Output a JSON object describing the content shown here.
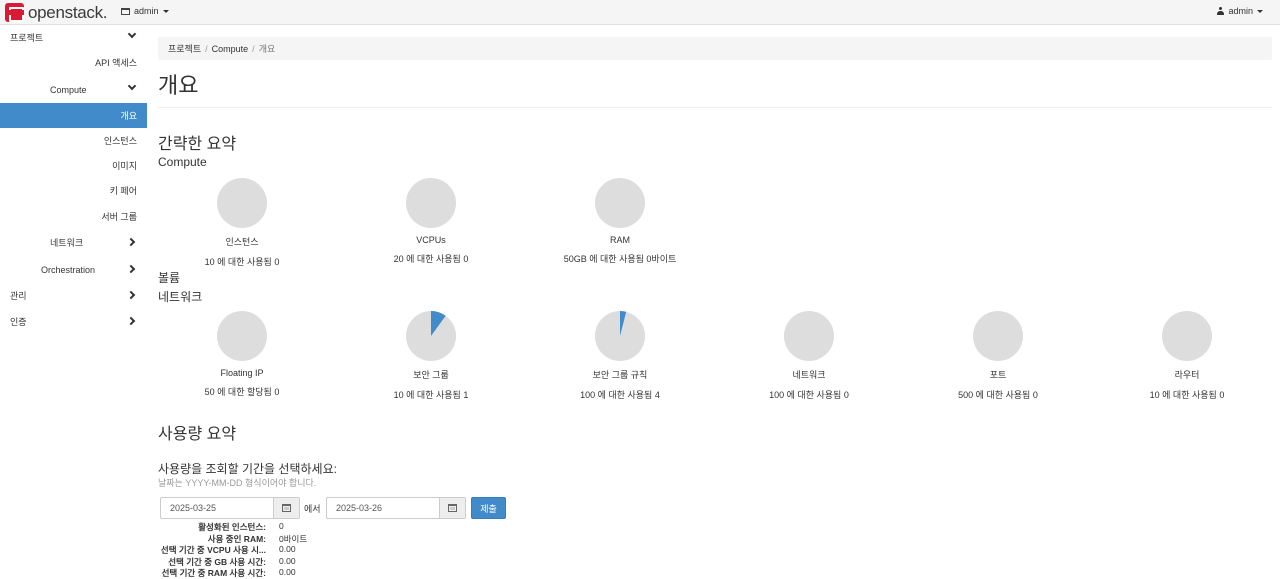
{
  "header": {
    "brand": "openstack.",
    "project": "admin",
    "user": "admin"
  },
  "sidebar": {
    "project": "프로젝트",
    "api_access": "API 액세스",
    "compute": "Compute",
    "overview": "개요",
    "instances": "인스턴스",
    "images": "이미지",
    "keypairs": "키 페어",
    "server_groups": "서버 그룹",
    "network": "네트워크",
    "orchestration": "Orchestration",
    "admin": "관리",
    "identity": "인증"
  },
  "breadcrumb": {
    "project": "프로젝트",
    "compute": "Compute",
    "current": "개요",
    "sep": "/"
  },
  "page": {
    "title": "개요"
  },
  "limit_summary": {
    "title": "간략한 요약",
    "compute_heading": "Compute",
    "volume_heading": "볼륨",
    "network_heading": "네트워크",
    "compute": [
      {
        "label": "인스턴스",
        "usage": "10 에 대한 사용됨 0",
        "used": 0,
        "total": 10
      },
      {
        "label": "VCPUs",
        "usage": "20 에 대한 사용됨 0",
        "used": 0,
        "total": 20
      },
      {
        "label": "RAM",
        "usage": "50GB 에 대한 사용됨 0바이트",
        "used": 0,
        "total": 50
      }
    ],
    "network": [
      {
        "label": "Floating IP",
        "usage": "50 에 대한 할당됨 0",
        "used": 0,
        "total": 50
      },
      {
        "label": "보안 그룹",
        "usage": "10 에 대한 사용됨 1",
        "used": 1,
        "total": 10
      },
      {
        "label": "보안 그룹 규칙",
        "usage": "100 에 대한 사용됨 4",
        "used": 4,
        "total": 100
      },
      {
        "label": "네트워크",
        "usage": "100 에 대한 사용됨 0",
        "used": 0,
        "total": 100
      },
      {
        "label": "포트",
        "usage": "500 에 대한 사용됨 0",
        "used": 0,
        "total": 500
      },
      {
        "label": "라우터",
        "usage": "10 에 대한 사용됨 0",
        "used": 0,
        "total": 10
      }
    ]
  },
  "usage_summary": {
    "title": "사용량 요약",
    "prompt": "사용량을 조회할 기간을 선택하세요:",
    "hint": "날짜는 YYYY-MM-DD 형식이어야 합니다.",
    "start": "2025-03-25",
    "between": "에서",
    "end": "2025-03-26",
    "submit": "제출",
    "stats": [
      {
        "key": "활성화된 인스턴스:",
        "value": "0"
      },
      {
        "key": "사용 중인 RAM:",
        "value": "0바이트"
      },
      {
        "key": "선택 기간 중 VCPU 사용 시...",
        "value": "0.00"
      },
      {
        "key": "선택 기간 중 GB 사용 시간:",
        "value": "0.00"
      },
      {
        "key": "선택 기간 중 RAM 사용 시간:",
        "value": "0.00"
      }
    ]
  },
  "colors": {
    "accent": "#428bca",
    "pie_bg": "#dddddd",
    "brand": "#da1a32"
  }
}
